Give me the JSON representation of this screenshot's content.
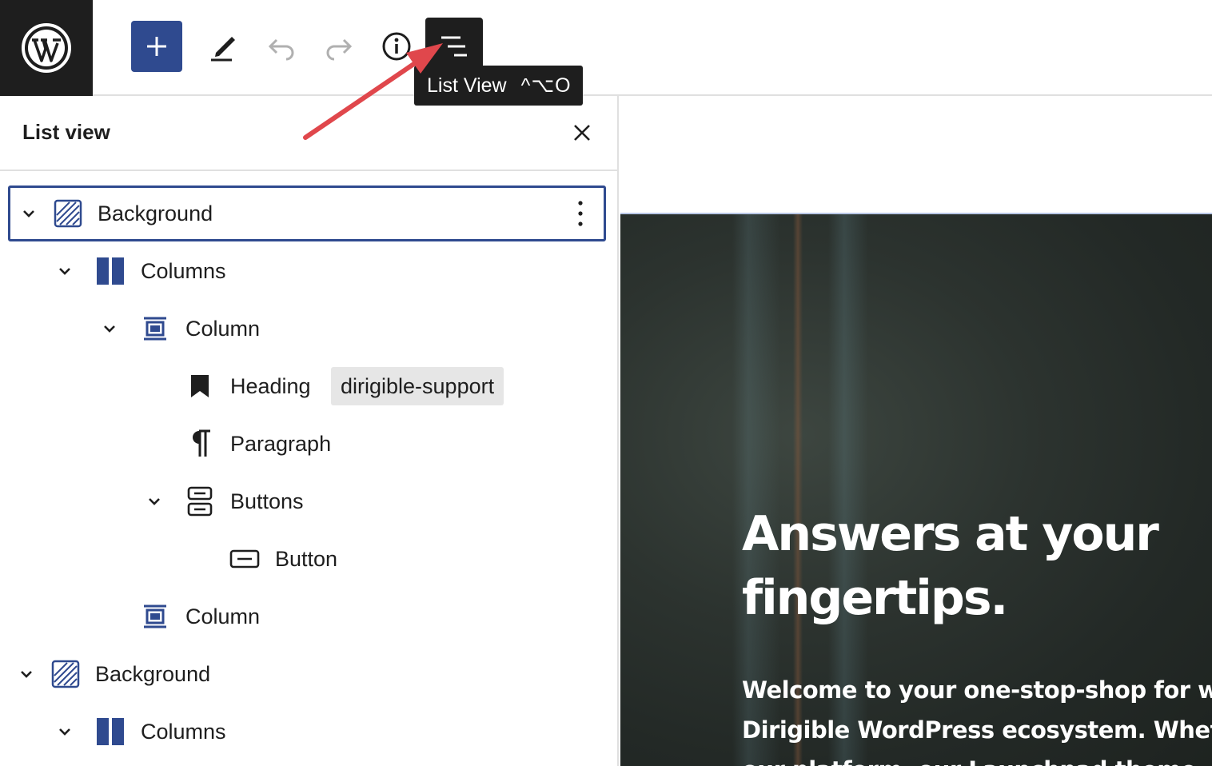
{
  "toolbar": {
    "logo_icon": "wordpress-logo-icon",
    "add_icon": "plus-icon",
    "edit_icon": "pencil-icon",
    "undo_icon": "undo-icon",
    "redo_icon": "redo-icon",
    "info_icon": "info-icon",
    "list_view_icon": "list-view-icon",
    "accent_color": "#2f4a8f"
  },
  "tooltip": {
    "label": "List View",
    "shortcut": "^⌥O"
  },
  "list_view": {
    "title": "List view",
    "close_icon": "close-icon",
    "items": [
      {
        "label": "Background",
        "icon": "cover-block-icon",
        "depth": 0,
        "expanded": true,
        "selected": true
      },
      {
        "label": "Columns",
        "icon": "columns-block-icon",
        "depth": 1,
        "expanded": true
      },
      {
        "label": "Column",
        "icon": "column-block-icon",
        "depth": 2,
        "expanded": true
      },
      {
        "label": "Heading",
        "icon": "heading-bookmark-icon",
        "depth": 3,
        "anchor": "dirigible-support"
      },
      {
        "label": "Paragraph",
        "icon": "paragraph-icon",
        "depth": 3
      },
      {
        "label": "Buttons",
        "icon": "buttons-block-icon",
        "depth": 3,
        "expanded": true
      },
      {
        "label": "Button",
        "icon": "button-block-icon",
        "depth": 4
      },
      {
        "label": "Column",
        "icon": "column-block-icon",
        "depth": 2
      },
      {
        "label": "Background",
        "icon": "cover-block-icon",
        "depth": 0,
        "expanded": true
      },
      {
        "label": "Columns",
        "icon": "columns-block-icon",
        "depth": 1,
        "expanded": true
      }
    ]
  },
  "canvas": {
    "heading_line1": "Answers at your",
    "heading_highlight": "fingertips.",
    "highlight_color": "#e9a957",
    "paragraph_lines": [
      "Welcome to your one-stop-shop for wo",
      "Dirigible WordPress ecosystem. Whethe",
      "our platform, our Launchpad theme, or"
    ]
  }
}
